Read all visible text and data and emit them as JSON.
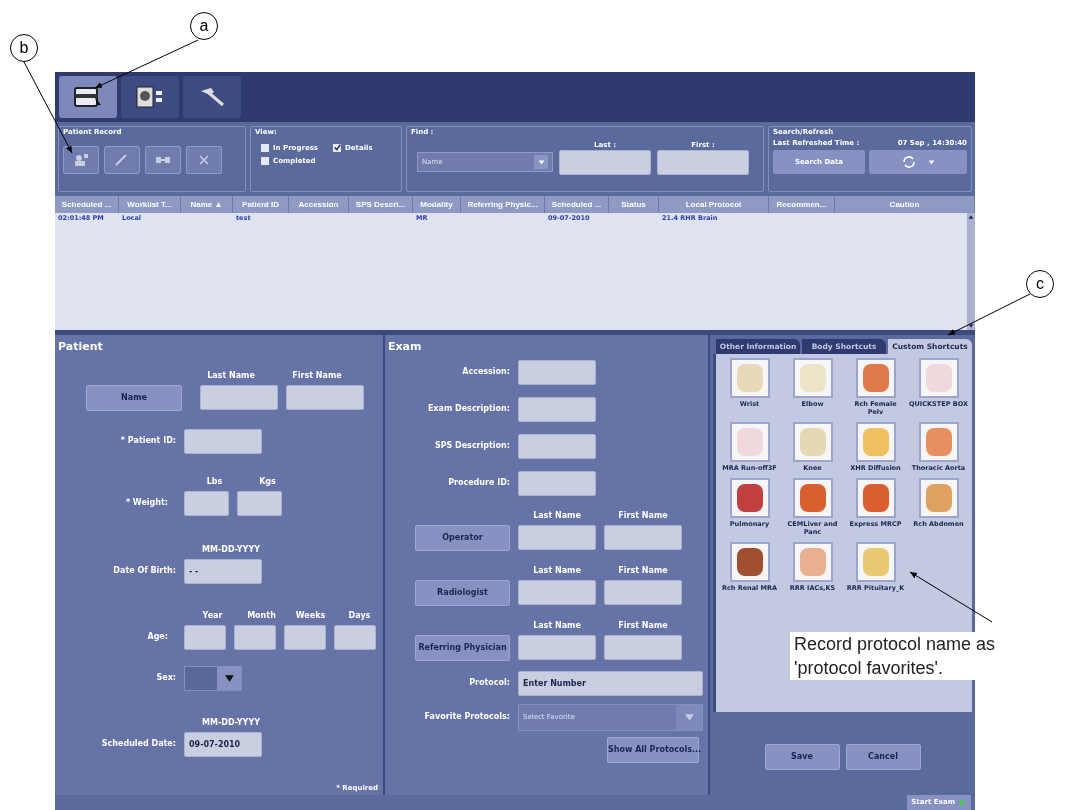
{
  "callouts": [
    {
      "label": "a"
    },
    {
      "label": "b"
    },
    {
      "label": "c"
    }
  ],
  "annotation": {
    "text": "Record protocol name as 'protocol favorites'."
  },
  "toolbar": {
    "tabs": [
      {
        "kind": "patient",
        "selected": true
      },
      {
        "kind": "viewer",
        "selected": false
      },
      {
        "kind": "tools",
        "selected": false
      }
    ]
  },
  "patient_record": {
    "title": "Patient Record",
    "buttons": [
      {
        "kind": "new"
      },
      {
        "kind": "edit"
      },
      {
        "kind": "link"
      },
      {
        "kind": "delete"
      }
    ]
  },
  "view": {
    "title": "View:",
    "options": [
      {
        "label": "In Progress",
        "checked": false
      },
      {
        "label": "Details",
        "checked": true
      },
      {
        "label": "Completed",
        "checked": false
      }
    ]
  },
  "find": {
    "title": "Find :",
    "dropdown": {
      "placeholder": "Name"
    },
    "last_label": "Last :",
    "first_label": "First :"
  },
  "search_refresh": {
    "title": "Search/Refresh",
    "refreshed_label": "Last Refreshed Time :",
    "refreshed_time": "07 Sep , 14:30:40",
    "search_button": "Search Data"
  },
  "table": {
    "columns": [
      "Scheduled ...",
      "Worklist T...",
      "Name ▲",
      "Patient ID",
      "Accession",
      "SPS Descri...",
      "Modality",
      "Referring Physic...",
      "Scheduled ...",
      "Status",
      "Local Protocol",
      "Recommen...",
      "Caution"
    ],
    "rows": [
      {
        "selected": false,
        "cells": {
          "0": "02:01:48 PM",
          "1": "Local",
          "3": "test",
          "6": "MR",
          "8": "09-07-2010",
          "10": "21.4 RHR Brain"
        }
      }
    ]
  },
  "patient": {
    "title": "Patient",
    "last_name": "Last Name",
    "first_name": "First Name",
    "name_button": "Name",
    "patient_id_label": "* Patient ID:",
    "lbs": "Lbs",
    "kgs": "Kgs",
    "weight_label": "* Weight:",
    "dob_format": "MM-DD-YYYY",
    "dob_label": "Date Of Birth:",
    "dob_value": "- -",
    "age_units": [
      "Year",
      "Month",
      "Weeks",
      "Days"
    ],
    "age_label": "Age:",
    "sex_label": "Sex:",
    "sched_format": "MM-DD-YYYY",
    "sched_label": "Scheduled Date:",
    "sched_value": "09-07-2010",
    "required": "* Required"
  },
  "exam": {
    "title": "Exam",
    "fields": [
      "Accession:",
      "Exam Description:",
      "SPS Description:",
      "Procedure ID:"
    ],
    "people": [
      {
        "button": "Operator",
        "last_name": "Last Name",
        "first_name": "First Name"
      },
      {
        "button": "Radiologist",
        "last_name": "Last Name",
        "first_name": "First Name"
      },
      {
        "button": "Referring Physician",
        "last_name": "Last Name",
        "first_name": "First Name"
      }
    ],
    "protocol_label": "Protocol:",
    "protocol_value": "Enter Number",
    "favorites_label": "Favorite Protocols:",
    "favorites_placeholder": "Select Favorite",
    "show_all": "Show All Protocols..."
  },
  "shortcuts": {
    "tabs": [
      {
        "label": "Other Information",
        "selected": false
      },
      {
        "label": "Body Shortcuts",
        "selected": false
      },
      {
        "label": "Custom Shortcuts",
        "selected": true
      }
    ],
    "items": [
      {
        "label": "Wrist",
        "color": "#e8d9b8"
      },
      {
        "label": "Elbow",
        "color": "#ece3c8"
      },
      {
        "label": "Rch Female Pelv",
        "color": "#e07a4a"
      },
      {
        "label": "QUICKSTEP BOX",
        "color": "#f0d8dc"
      },
      {
        "label": "MRA Run-off3F",
        "color": "#f0d8dc"
      },
      {
        "label": "Knee",
        "color": "#e5d8b5"
      },
      {
        "label": "XHR Diffusion",
        "color": "#f0c060"
      },
      {
        "label": "Thoracic Aorta",
        "color": "#e89060"
      },
      {
        "label": "Pulmonary",
        "color": "#c04040"
      },
      {
        "label": "CEMLiver and Panc",
        "color": "#d86030"
      },
      {
        "label": "Express MRCP",
        "color": "#d86030"
      },
      {
        "label": "Rch Abdomen",
        "color": "#e0a060"
      },
      {
        "label": "Rch Renal MRA",
        "color": "#a05030"
      },
      {
        "label": "RRR IACs,KS",
        "color": "#e8b090"
      },
      {
        "label": "RRR Pituitary_K",
        "color": "#e8c870"
      }
    ],
    "save": "Save",
    "cancel": "Cancel"
  },
  "status_bar": {
    "start_exam": "Start Exam"
  }
}
